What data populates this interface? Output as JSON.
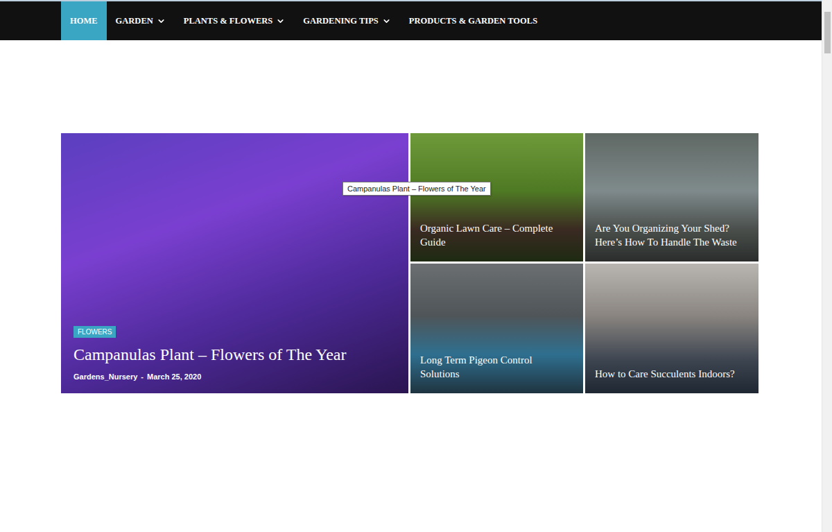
{
  "nav": {
    "items": [
      {
        "label": "HOME",
        "selected": true,
        "dropdown": false
      },
      {
        "label": "GARDEN",
        "selected": false,
        "dropdown": true
      },
      {
        "label": "PLANTS & FLOWERS",
        "selected": false,
        "dropdown": true
      },
      {
        "label": "GARDENING TIPS",
        "selected": false,
        "dropdown": true
      },
      {
        "label": "PRODUCTS & GARDEN TOOLS",
        "selected": false,
        "dropdown": false
      }
    ]
  },
  "featured": {
    "category": "FLOWERS",
    "title": "Campanulas Plant – Flowers of The Year",
    "author": "Gardens_Nursery",
    "separator": "-",
    "date": "March 25, 2020"
  },
  "cards": [
    {
      "title": "Organic Lawn Care – Complete Guide"
    },
    {
      "title": "Are You Organizing Your Shed? Here’s How To Handle The Waste"
    },
    {
      "title": "Long Term Pigeon Control Solutions"
    },
    {
      "title": "How to Care Succulents Indoors?"
    }
  ],
  "tooltip": {
    "text": "Campanulas Plant – Flowers of The Year"
  }
}
